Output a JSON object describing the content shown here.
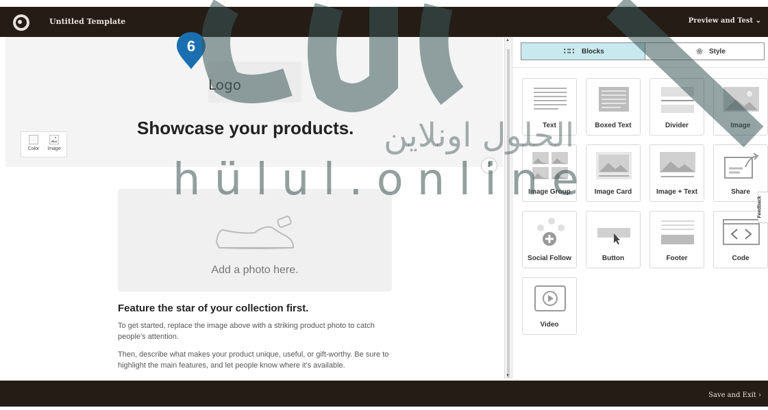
{
  "topbar": {
    "logo_icon": "mailchimp-logo-icon",
    "title": "Untitled Template",
    "preview_label": "Preview and Test",
    "preview_icon": "chevron-down-icon"
  },
  "canvas": {
    "logo_placeholder": "Logo",
    "headline": "Showcase your products.",
    "bg_tools": [
      {
        "label": "Color",
        "icon": "color-swatch-icon"
      },
      {
        "label": "Image",
        "icon": "image-icon"
      }
    ],
    "photo_placeholder": "Add a photo here.",
    "photo_icon": "shoe-icon",
    "feature_title": "Feature the star of your collection first.",
    "paragraph_1": "To get started, replace the image above with a striking product photo to catch people's attention.",
    "paragraph_2": "Then, describe what makes your product unique, useful, or gift-worthy. Be sure to highlight the main features, and let people know where it's available.",
    "scroll_handle_icon": "up-down-arrows-icon"
  },
  "panel": {
    "tabs": [
      {
        "label": "Blocks",
        "icon": "grid-dots-icon",
        "active": true
      },
      {
        "label": "Style",
        "icon": "paint-brush-icon",
        "active": false
      }
    ],
    "blocks": [
      {
        "label": "Text",
        "icon": "text-block-icon"
      },
      {
        "label": "Boxed Text",
        "icon": "boxed-text-icon"
      },
      {
        "label": "Divider",
        "icon": "divider-icon"
      },
      {
        "label": "Image",
        "icon": "image-icon"
      },
      {
        "label": "Image Group",
        "icon": "image-group-icon"
      },
      {
        "label": "Image Card",
        "icon": "image-card-icon"
      },
      {
        "label": "Image + Text",
        "icon": "image-text-icon"
      },
      {
        "label": "Share",
        "icon": "share-icon"
      },
      {
        "label": "Social Follow",
        "icon": "social-follow-icon"
      },
      {
        "label": "Button",
        "icon": "button-icon"
      },
      {
        "label": "Footer",
        "icon": "footer-icon"
      },
      {
        "label": "Code",
        "icon": "code-icon"
      },
      {
        "label": "Video",
        "icon": "video-icon"
      }
    ],
    "feedback_label": "Feedback"
  },
  "badge": {
    "number": "6",
    "color": "#1a6fb0"
  },
  "bottombar": {
    "save_label": "Save and Exit",
    "save_icon": "chevron-right-icon"
  },
  "watermark": {
    "latin": "hülul.online",
    "arabic": "الحلول اونلاين"
  },
  "colors": {
    "topbar": "#241c15",
    "active_tab": "#c8e9ee",
    "badge": "#1a6fb0"
  }
}
